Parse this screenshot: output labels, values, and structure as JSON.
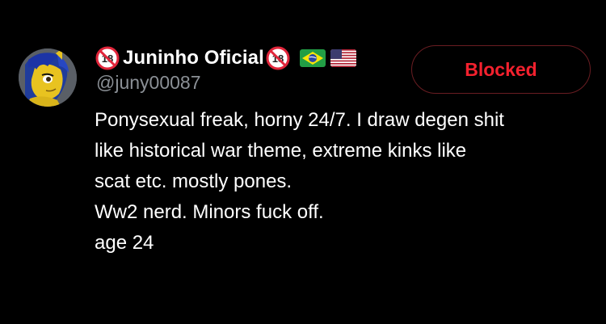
{
  "profile": {
    "display_name": "Juninho Oficial",
    "handle": "@juny00087",
    "avatar": "pony-avatar",
    "badges": {
      "left": "no-under-18-icon",
      "right": "no-under-18-icon",
      "flags": [
        "brazil-flag-icon",
        "usa-flag-icon"
      ]
    },
    "bio_lines": [
      "Ponysexual freak, horny 24/7. I draw degen shit",
      "like historical war theme, extreme kinks like",
      "scat etc. mostly pones.",
      "Ww2 nerd. Minors fuck off.",
      "age 24"
    ]
  },
  "actions": {
    "blocked_label": "Blocked"
  },
  "colors": {
    "background": "#000000",
    "text": "#ffffff",
    "handle": "#8b9096",
    "blocked_text": "#f4212e",
    "blocked_border": "#6a1d22"
  }
}
